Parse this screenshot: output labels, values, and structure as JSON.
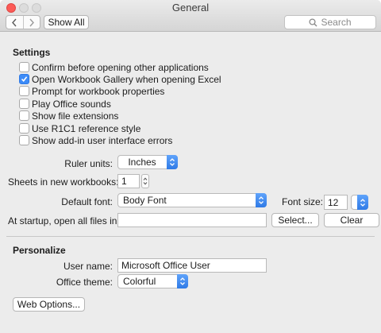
{
  "window": {
    "title": "General"
  },
  "toolbar": {
    "back_icon": "chevron-left-icon",
    "forward_icon": "chevron-right-icon",
    "show_all_label": "Show All",
    "search_placeholder": "Search",
    "search_icon": "search-icon"
  },
  "settings": {
    "title": "Settings",
    "options": [
      {
        "label": "Confirm before opening other applications",
        "checked": false
      },
      {
        "label": "Open Workbook Gallery when opening Excel",
        "checked": true
      },
      {
        "label": "Prompt for workbook properties",
        "checked": false
      },
      {
        "label": "Play Office sounds",
        "checked": false
      },
      {
        "label": "Show file extensions",
        "checked": false
      },
      {
        "label": "Use R1C1 reference style",
        "checked": false
      },
      {
        "label": "Show add-in user interface errors",
        "checked": false
      }
    ],
    "ruler_units_label": "Ruler units:",
    "ruler_units_value": "Inches",
    "sheets_label": "Sheets in new workbooks:",
    "sheets_value": "1",
    "default_font_label": "Default font:",
    "default_font_value": "Body Font",
    "font_size_label": "Font size:",
    "font_size_value": "12",
    "startup_label": "At startup, open all files in:",
    "startup_value": "",
    "select_button": "Select...",
    "clear_button": "Clear"
  },
  "personalize": {
    "title": "Personalize",
    "user_name_label": "User name:",
    "user_name_value": "Microsoft Office User",
    "theme_label": "Office theme:",
    "theme_value": "Colorful"
  },
  "web_options_button": "Web Options...",
  "colors": {
    "accent": "#3d8bf7",
    "close_button": "#fc5b57"
  }
}
